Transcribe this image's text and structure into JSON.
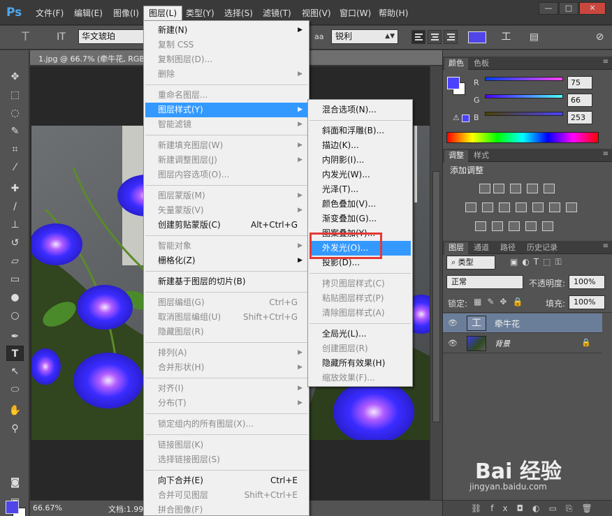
{
  "app": {
    "logo": "Ps"
  },
  "menubar": [
    "文件(F)",
    "编辑(E)",
    "图像(I)",
    "图层(L)",
    "类型(Y)",
    "选择(S)",
    "滤镜(T)",
    "视图(V)",
    "窗口(W)",
    "帮助(H)"
  ],
  "window_buttons": [
    "—",
    "□",
    "✕"
  ],
  "options": {
    "font_family": "华文琥珀",
    "aa_label": "aa",
    "antialias": "锐利",
    "color": "#4f45e8"
  },
  "document": {
    "tab_title": "1.jpg @ 66.7% (牵牛花, RGB",
    "zoom": "66.67%",
    "doc_info": "文档:1.99"
  },
  "colors_panel": {
    "tabs": [
      "颜色",
      "色板"
    ],
    "r_label": "R",
    "g_label": "G",
    "b_label": "B",
    "r": "75",
    "g": "66",
    "b": "253",
    "fg_color": "#4b42fd"
  },
  "adjust_panel": {
    "tabs": [
      "调整",
      "样式"
    ],
    "title": "添加调整"
  },
  "layers_panel": {
    "tabs": [
      "图层",
      "通道",
      "路径",
      "历史记录"
    ],
    "filter": "类型",
    "blend": "正常",
    "opacity_label": "不透明度:",
    "opacity": "100%",
    "lock_label": "锁定:",
    "fill_label": "填充:",
    "fill": "100%",
    "layers": [
      {
        "name": "牵牛花",
        "type": "text",
        "selected": true
      },
      {
        "name": "背景",
        "type": "image",
        "selected": false
      }
    ]
  },
  "layer_menu": [
    {
      "label": "新建(N)",
      "sub": true
    },
    {
      "label": "复制 CSS",
      "dis": true
    },
    {
      "label": "复制图层(D)...",
      "dis": true
    },
    {
      "label": "删除",
      "sub": true,
      "dis": true
    },
    {
      "sep": true
    },
    {
      "label": "重命名图层...",
      "dis": true
    },
    {
      "label": "图层样式(Y)",
      "sub": true,
      "hl": true
    },
    {
      "label": "智能滤镜",
      "sub": true,
      "dis": true
    },
    {
      "sep": true
    },
    {
      "label": "新建填充图层(W)",
      "sub": true,
      "dis": true
    },
    {
      "label": "新建调整图层(J)",
      "sub": true,
      "dis": true
    },
    {
      "label": "图层内容选项(O)...",
      "dis": true
    },
    {
      "sep": true
    },
    {
      "label": "图层蒙版(M)",
      "sub": true,
      "dis": true
    },
    {
      "label": "矢量蒙版(V)",
      "sub": true,
      "dis": true
    },
    {
      "label": "创建剪贴蒙版(C)",
      "sc": "Alt+Ctrl+G"
    },
    {
      "sep": true
    },
    {
      "label": "智能对象",
      "sub": true,
      "dis": true
    },
    {
      "label": "栅格化(Z)",
      "sub": true
    },
    {
      "sep": true
    },
    {
      "label": "新建基于图层的切片(B)"
    },
    {
      "sep": true
    },
    {
      "label": "图层编组(G)",
      "sc": "Ctrl+G",
      "dis": true
    },
    {
      "label": "取消图层编组(U)",
      "sc": "Shift+Ctrl+G",
      "dis": true
    },
    {
      "label": "隐藏图层(R)",
      "dis": true
    },
    {
      "sep": true
    },
    {
      "label": "排列(A)",
      "sub": true,
      "dis": true
    },
    {
      "label": "合并形状(H)",
      "sub": true,
      "dis": true
    },
    {
      "sep": true
    },
    {
      "label": "对齐(I)",
      "sub": true,
      "dis": true
    },
    {
      "label": "分布(T)",
      "sub": true,
      "dis": true
    },
    {
      "sep": true
    },
    {
      "label": "锁定组内的所有图层(X)...",
      "dis": true
    },
    {
      "sep": true
    },
    {
      "label": "链接图层(K)",
      "dis": true
    },
    {
      "label": "选择链接图层(S)",
      "dis": true
    },
    {
      "sep": true
    },
    {
      "label": "向下合并(E)",
      "sc": "Ctrl+E"
    },
    {
      "label": "合并可见图层",
      "sc": "Shift+Ctrl+E",
      "dis": true
    },
    {
      "label": "拼合图像(F)",
      "dis": true
    }
  ],
  "style_menu": [
    {
      "label": "混合选项(N)..."
    },
    {
      "sep": true
    },
    {
      "label": "斜面和浮雕(B)..."
    },
    {
      "label": "描边(K)..."
    },
    {
      "label": "内阴影(I)..."
    },
    {
      "label": "内发光(W)..."
    },
    {
      "label": "光泽(T)..."
    },
    {
      "label": "颜色叠加(V)..."
    },
    {
      "label": "渐变叠加(G)..."
    },
    {
      "label": "图案叠加(Y)..."
    },
    {
      "label": "外发光(O)...",
      "hl": true
    },
    {
      "label": "投影(D)..."
    },
    {
      "sep": true
    },
    {
      "label": "拷贝图层样式(C)",
      "dis": true
    },
    {
      "label": "粘贴图层样式(P)",
      "dis": true
    },
    {
      "label": "清除图层样式(A)",
      "dis": true
    },
    {
      "sep": true
    },
    {
      "label": "全局光(L)..."
    },
    {
      "label": "创建图层(R)",
      "dis": true
    },
    {
      "label": "隐藏所有效果(H)"
    },
    {
      "label": "缩放效果(F)...",
      "dis": true
    }
  ],
  "watermark": {
    "brand": "Bai 经验",
    "url": "jingyan.baidu.com"
  }
}
